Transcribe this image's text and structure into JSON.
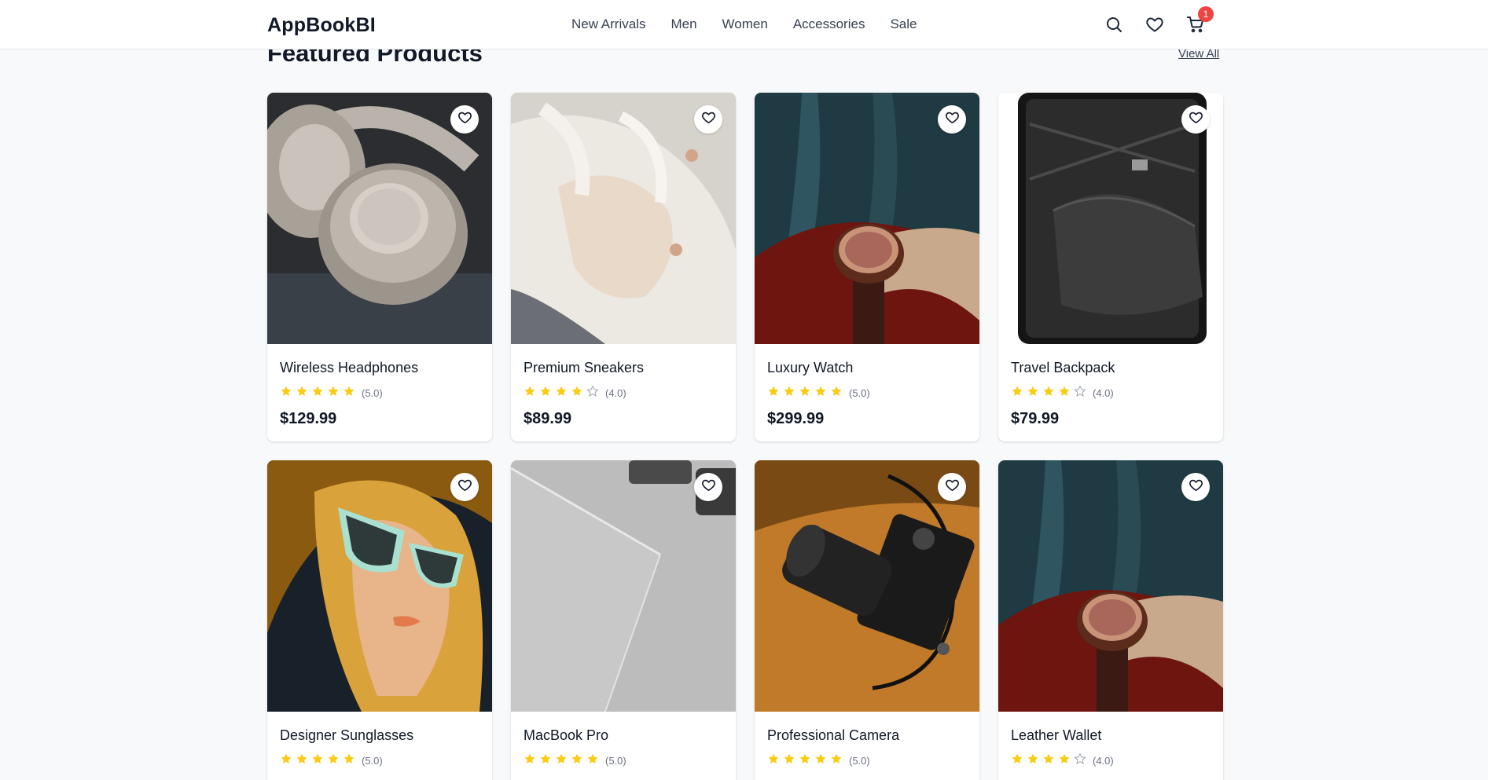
{
  "header": {
    "logo": "AppBookBI",
    "nav": [
      "New Arrivals",
      "Men",
      "Women",
      "Accessories",
      "Sale"
    ],
    "cart_count": "1",
    "icons": [
      "search-icon",
      "heart-icon",
      "cart-icon"
    ]
  },
  "section": {
    "title": "Featured Products",
    "view_all": "View All"
  },
  "colors": {
    "star": "#facc15",
    "badge": "#ef4444",
    "page_bg": "#f8f9fa"
  },
  "products": [
    {
      "name": "Wireless Headphones",
      "rating": 5,
      "rating_text": "(5.0)",
      "price": "$129.99",
      "image": "headphones"
    },
    {
      "name": "Premium Sneakers",
      "rating": 4,
      "rating_text": "(4.0)",
      "price": "$89.99",
      "image": "sneakers"
    },
    {
      "name": "Luxury Watch",
      "rating": 5,
      "rating_text": "(5.0)",
      "price": "$299.99",
      "image": "watch"
    },
    {
      "name": "Travel Backpack",
      "rating": 4,
      "rating_text": "(4.0)",
      "price": "$79.99",
      "image": "suitcase"
    },
    {
      "name": "Designer Sunglasses",
      "rating": 5,
      "rating_text": "(5.0)",
      "price": "",
      "image": "sunglasses"
    },
    {
      "name": "MacBook Pro",
      "rating": 5,
      "rating_text": "(5.0)",
      "price": "",
      "image": "laptop"
    },
    {
      "name": "Professional Camera",
      "rating": 5,
      "rating_text": "(5.0)",
      "price": "",
      "image": "camera"
    },
    {
      "name": "Leather Wallet",
      "rating": 4,
      "rating_text": "(4.0)",
      "price": "",
      "image": "watch"
    }
  ]
}
